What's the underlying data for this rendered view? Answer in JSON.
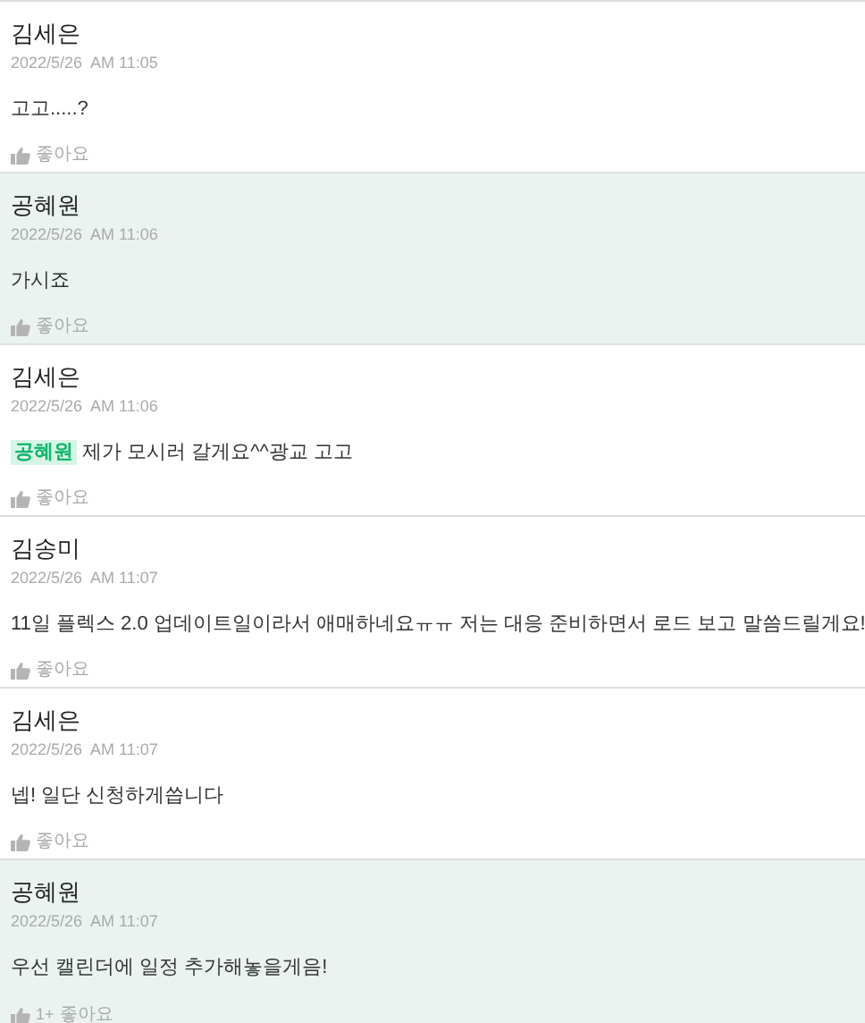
{
  "comments": [
    {
      "author": "김세은",
      "time": "2022/5/26  AM 11:05",
      "text": "고고.....?",
      "highlighted": false,
      "like_label": "좋아요"
    },
    {
      "author": "공혜원",
      "time": "2022/5/26  AM 11:06",
      "text": "가시죠",
      "highlighted": true,
      "like_label": "좋아요"
    },
    {
      "author": "김세은",
      "time": "2022/5/26  AM 11:06",
      "mention": "공혜원",
      "text": "제가 모시러 갈게요^^광교 고고",
      "highlighted": false,
      "like_label": "좋아요"
    },
    {
      "author": "김송미",
      "time": "2022/5/26  AM 11:07",
      "text": "11일 플렉스 2.0 업데이트일이라서 애매하네요ㅠㅠ 저는 대응 준비하면서 로드 보고 말씀드릴게요!",
      "highlighted": false,
      "like_label": "좋아요"
    },
    {
      "author": "김세은",
      "time": "2022/5/26  AM 11:07",
      "text": "넵! 일단 신청하게씁니다",
      "highlighted": false,
      "like_label": "좋아요"
    },
    {
      "author": "공혜원",
      "time": "2022/5/26  AM 11:07",
      "text": "우선 캘린더에 일정 추가해놓을게음!",
      "highlighted": true,
      "like_count": "1+",
      "like_label": "좋아요"
    }
  ]
}
